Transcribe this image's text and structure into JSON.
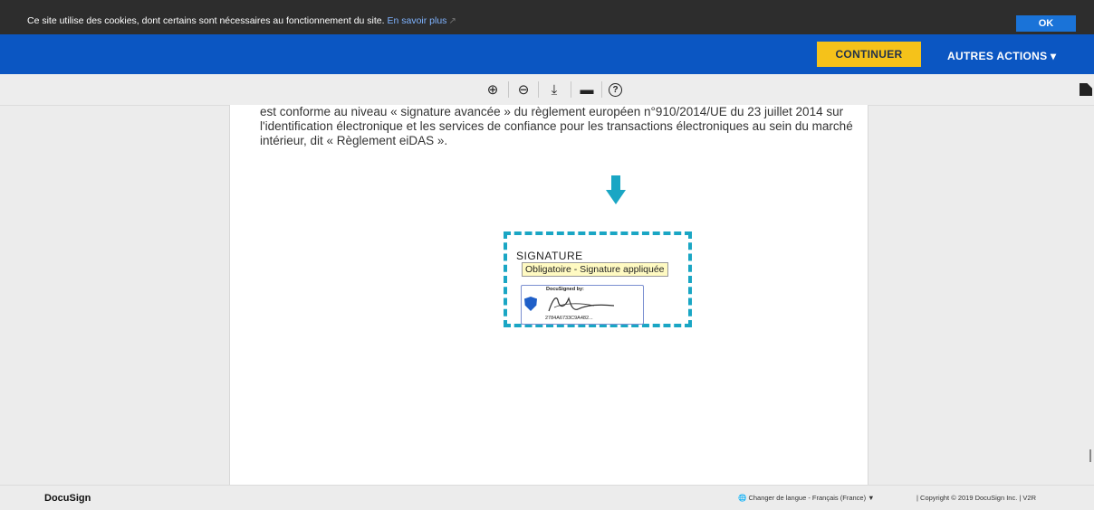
{
  "cookie_bar": {
    "message": "Ce site utilise des cookies, dont certains sont nécessaires au fonctionnement du site.",
    "learn_more": "En savoir plus",
    "ok_label": "OK"
  },
  "header": {
    "continue_label": "CONTINUER",
    "more_actions_label": "AUTRES ACTIONS ▾"
  },
  "toolbar": {
    "zoom_in_icon": "⊕",
    "zoom_out_icon": "⊖",
    "download_icon": "⤓",
    "print_icon": "▬",
    "help_icon": "?"
  },
  "document": {
    "text": "est conforme au niveau « signature avancée » du règlement européen n°910/2014/UE du 23 juillet 2014 sur l'identification électronique et les services de confiance pour les transactions électroniques au sein du marché intérieur, dit « Règlement eiDAS ».",
    "signature_label": "SIGNATURE",
    "tooltip": "Obligatoire - Signature appliquée",
    "signed_by": "DocuSigned by:",
    "signature_id": "2784A6733C9A482..."
  },
  "footer": {
    "brand": "DocuSign",
    "language": "Changer de langue - Français (France) ▼",
    "copyright": "| Copyright © 2019 DocuSign Inc. | V2R"
  },
  "colors": {
    "header_blue": "#0b56c2",
    "continue_yellow": "#f5c21a",
    "highlight_teal": "#1aa6c4"
  }
}
